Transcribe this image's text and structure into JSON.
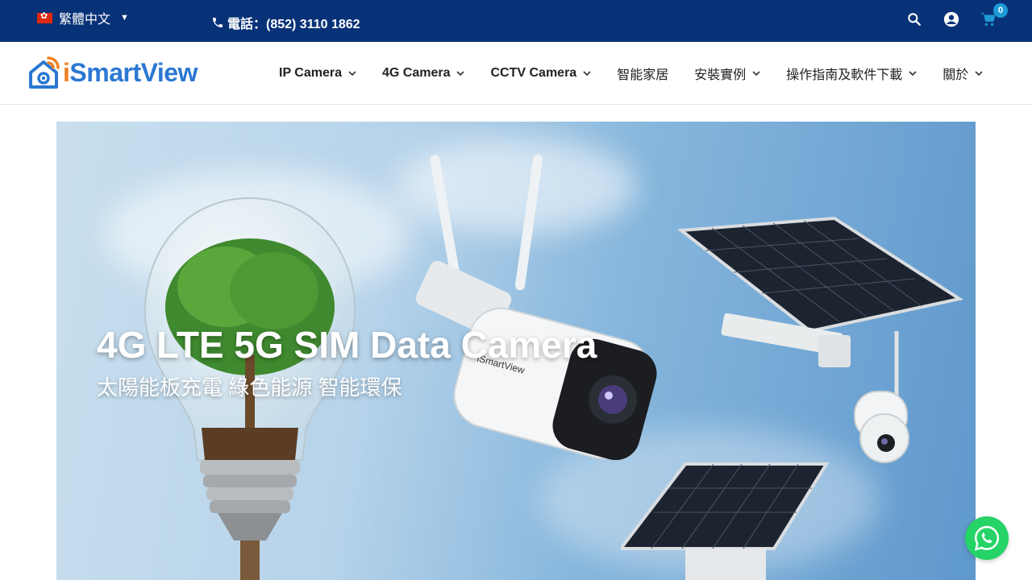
{
  "topbar": {
    "language": "繁體中文",
    "phone": "電話：(852) 3110 1862",
    "cart_count": "0"
  },
  "logo": {
    "prefix": "i",
    "name": "SmartView"
  },
  "nav": {
    "items": [
      {
        "label": "IP Camera",
        "has_dropdown": true
      },
      {
        "label": "4G Camera",
        "has_dropdown": true
      },
      {
        "label": "CCTV Camera",
        "has_dropdown": true
      },
      {
        "label": "智能家居",
        "has_dropdown": false
      },
      {
        "label": "安裝實例",
        "has_dropdown": true
      },
      {
        "label": "操作指南及軟件下載",
        "has_dropdown": true
      },
      {
        "label": "關於",
        "has_dropdown": true
      }
    ]
  },
  "hero": {
    "title": "4G LTE 5G SIM Data Camera",
    "subtitle": "太陽能板充電 綠色能源 智能環保",
    "camera_brand": "iSmartView"
  },
  "colors": {
    "topbar_bg": "#083277",
    "logo_blue": "#2a78d2",
    "logo_orange": "#f0801f",
    "badge": "#1e9bd7",
    "whatsapp": "#25d366"
  },
  "icons": [
    "phone-icon",
    "search-icon",
    "account-icon",
    "cart-icon",
    "chevron-down-icon",
    "whatsapp-icon"
  ]
}
